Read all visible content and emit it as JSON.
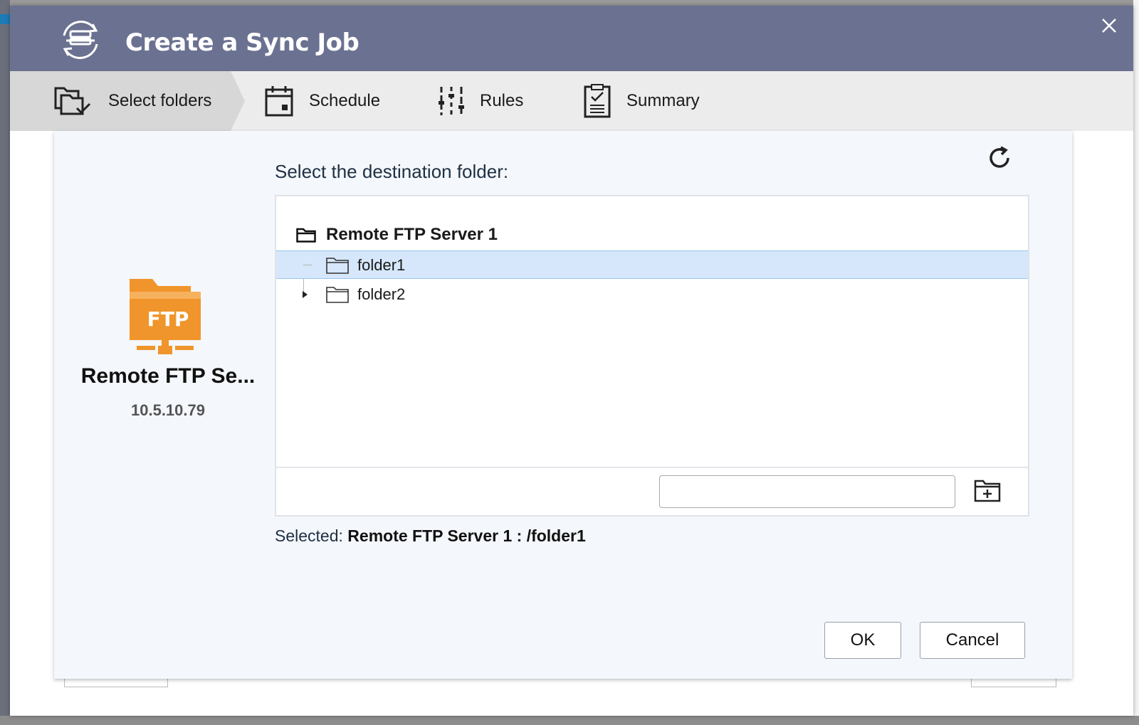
{
  "window": {
    "title": "Create a Sync Job"
  },
  "steps": [
    {
      "label": "Select folders",
      "icon": "select-folders-icon",
      "active": true
    },
    {
      "label": "Schedule",
      "icon": "calendar-icon",
      "active": false
    },
    {
      "label": "Rules",
      "icon": "sliders-icon",
      "active": false
    },
    {
      "label": "Summary",
      "icon": "clipboard-check-icon",
      "active": false
    }
  ],
  "source": {
    "logo_text": "FTP",
    "name": "Remote FTP Se...",
    "ip": "10.5.10.79"
  },
  "destination": {
    "prompt": "Select the destination folder:",
    "tree": {
      "root_label": "Remote FTP Server 1",
      "items": [
        {
          "label": "folder1",
          "selected": true,
          "expandable": false
        },
        {
          "label": "folder2",
          "selected": false,
          "expandable": true
        }
      ]
    },
    "new_folder_value": "",
    "selected_prefix": "Selected: ",
    "selected_path": "Remote FTP Server 1 : /folder1"
  },
  "buttons": {
    "ok": "OK",
    "cancel": "Cancel"
  },
  "colors": {
    "titlebar": "#6b7190",
    "accent_orange": "#f0952b",
    "selection": "#d6e7fb"
  }
}
